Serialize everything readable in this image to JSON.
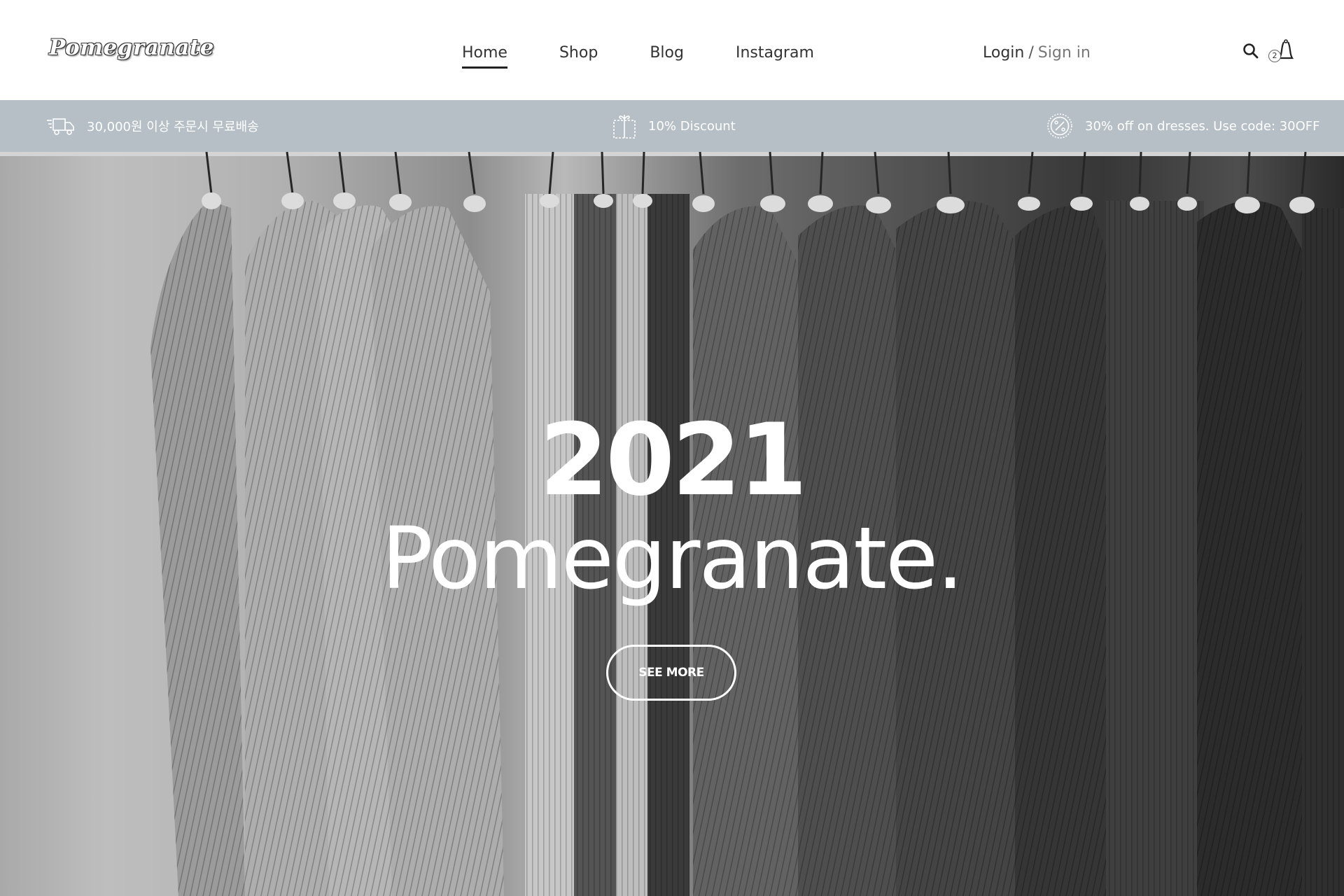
{
  "header": {
    "logo": "Pomegranate",
    "nav": [
      {
        "label": "Home",
        "active": true
      },
      {
        "label": "Shop",
        "active": false
      },
      {
        "label": "Blog",
        "active": false
      },
      {
        "label": "Instagram",
        "active": false
      }
    ],
    "auth": {
      "login": "Login",
      "separator": "/",
      "signin": "Sign in"
    },
    "cart_count": "2",
    "icons": {
      "search": "search-icon",
      "cart": "shopping-bag-icon"
    }
  },
  "promo": {
    "shipping": {
      "icon": "delivery-truck-icon",
      "text": "30,000원 이상 주문시 무료배송"
    },
    "discount": {
      "icon": "gift-box-icon",
      "text": "10% Discount"
    },
    "coupon": {
      "icon": "percent-badge-icon",
      "text": "30% off on dresses. Use code: 30OFF"
    },
    "bg_color": "#b5bfc5"
  },
  "hero": {
    "year": "2021",
    "brand": "Pomegranate.",
    "cta": "SEE MORE"
  }
}
